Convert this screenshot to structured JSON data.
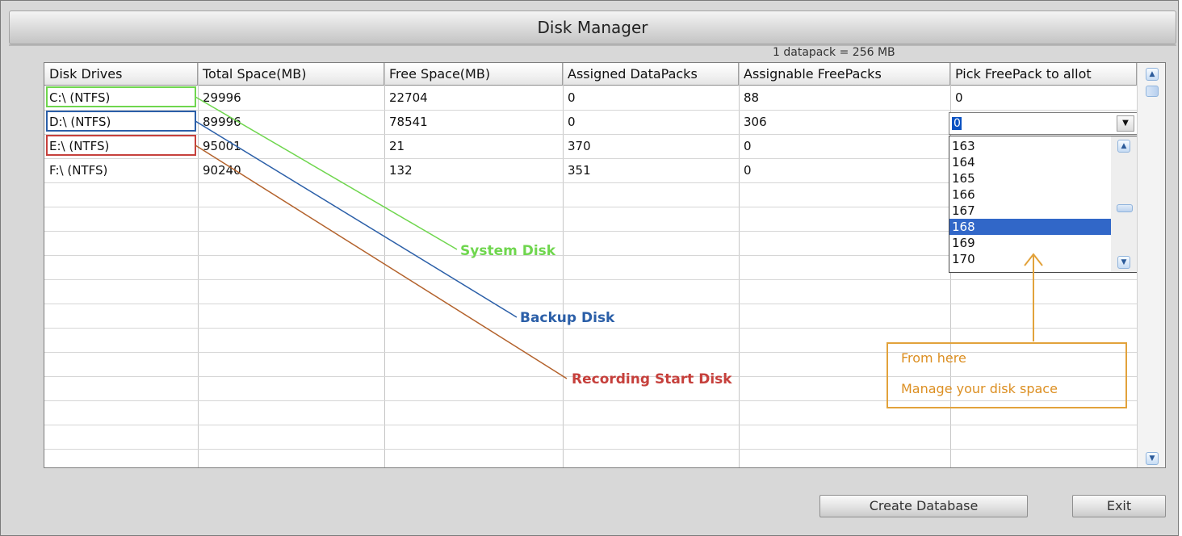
{
  "window": {
    "title": "Disk Manager",
    "pack_note": "1 datapack = 256 MB"
  },
  "table": {
    "columns": [
      "Disk Drives",
      "Total Space(MB)",
      "Free Space(MB)",
      "Assigned DataPacks",
      "Assignable FreePacks",
      "Pick FreePack to allot"
    ],
    "rows": [
      [
        "C:\\  (NTFS)",
        "29996",
        "22704",
        "0",
        "88",
        "0"
      ],
      [
        "D:\\  (NTFS)",
        "89996",
        "78541",
        "0",
        "306",
        "0"
      ],
      [
        "E:\\  (NTFS)",
        "95001",
        "21",
        "370",
        "0",
        ""
      ],
      [
        "F:\\  (NTFS)",
        "90240",
        "132",
        "351",
        "0",
        ""
      ]
    ]
  },
  "combo": {
    "value": "0",
    "options": [
      "163",
      "164",
      "165",
      "166",
      "167",
      "168",
      "169",
      "170"
    ],
    "selected": "168"
  },
  "annotations": {
    "system": "System Disk",
    "backup": "Backup Disk",
    "recording": "Recording Start Disk",
    "note_line1": "From here",
    "note_line2": "Manage your disk space"
  },
  "colors": {
    "system": "#6fd64e",
    "backup": "#2b5fa8",
    "recording": "#c6403c",
    "note": "#dc8f22",
    "selected": "#3167c8"
  },
  "buttons": {
    "create": "Create Database",
    "exit": "Exit"
  },
  "icons": [
    "scroll-up-icon",
    "scroll-down-icon",
    "dropdown-arrow-icon",
    "up-arrow-icon"
  ]
}
